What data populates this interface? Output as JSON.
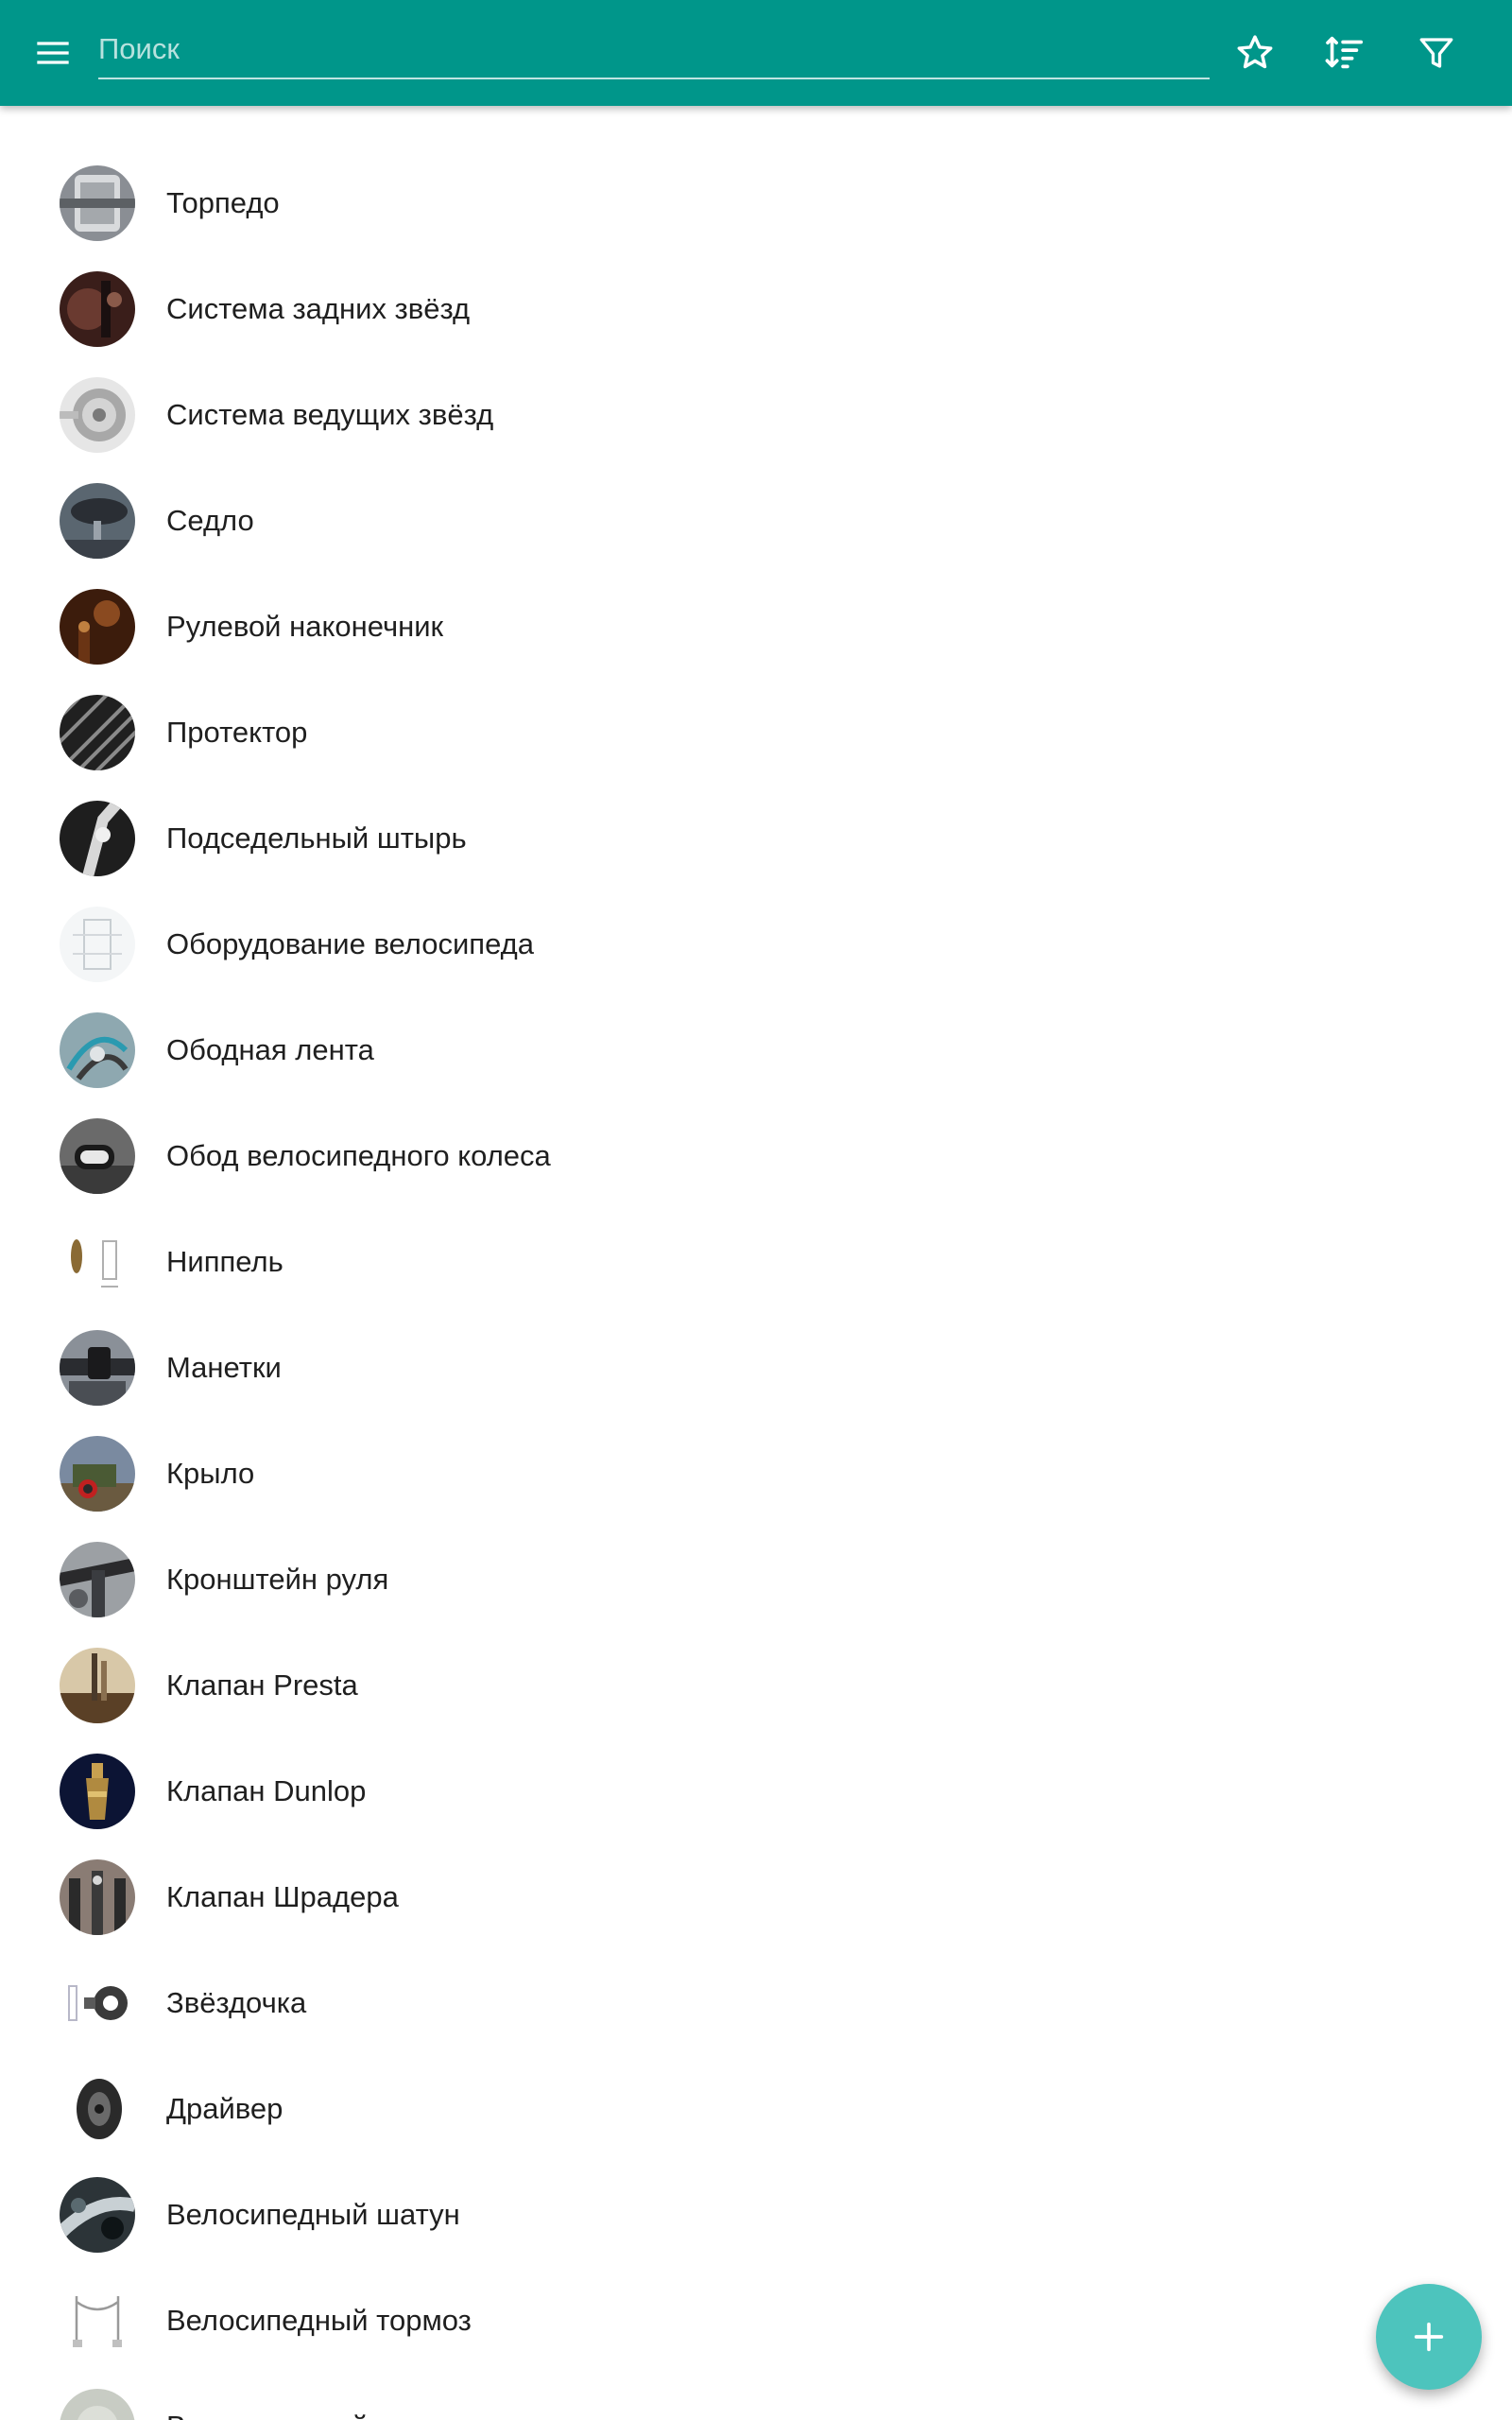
{
  "toolbar": {
    "menu_icon": "menu-icon",
    "search_placeholder": "Поиск",
    "search_value": "",
    "favorite_icon": "star-outline-icon",
    "sort_icon": "sort-icon",
    "filter_icon": "filter-icon",
    "color": "#00968a"
  },
  "items": [
    {
      "label": "Торпедо",
      "thumb_color": "#8a8e94"
    },
    {
      "label": "Система задних звёзд",
      "thumb_color": "#4a2a24"
    },
    {
      "label": "Система ведущих звёзд",
      "thumb_color": "#c9c9c9"
    },
    {
      "label": "Седло",
      "thumb_color": "#4f5a66"
    },
    {
      "label": "Рулевой наконечник",
      "thumb_color": "#4a2412"
    },
    {
      "label": "Протектор",
      "thumb_color": "#2c2c2c"
    },
    {
      "label": "Подседельный штырь",
      "thumb_color": "#2e2e2e"
    },
    {
      "label": "Оборудование велосипеда",
      "thumb_color": "#e8ecee"
    },
    {
      "label": "Ободная лента",
      "thumb_color": "#7c9aa4"
    },
    {
      "label": "Обод велосипедного колеса",
      "thumb_color": "#5a5a5a"
    },
    {
      "label": "Ниппель",
      "thumb_color": "#f4f4f4"
    },
    {
      "label": "Манетки",
      "thumb_color": "#555a60"
    },
    {
      "label": "Крыло",
      "thumb_color": "#7a5a44"
    },
    {
      "label": "Кронштейн руля",
      "thumb_color": "#6a6e72"
    },
    {
      "label": "Клапан Presta",
      "thumb_color": "#a88a60"
    },
    {
      "label": "Клапан Dunlop",
      "thumb_color": "#101a3a"
    },
    {
      "label": "Клапан Шрадера",
      "thumb_color": "#8a7a72"
    },
    {
      "label": "Звёздочка",
      "thumb_color": "#f2f2f2"
    },
    {
      "label": "Драйвер",
      "thumb_color": "#f4f4f4"
    },
    {
      "label": "Велосипедный шатун",
      "thumb_color": "#3c4448"
    },
    {
      "label": "Велосипедный тормоз",
      "thumb_color": "#f6f6f6"
    },
    {
      "label": "Велосипедный",
      "thumb_color": "#c8ccc4"
    }
  ],
  "fab": {
    "icon": "plus-icon",
    "color": "#4dc4bd"
  }
}
